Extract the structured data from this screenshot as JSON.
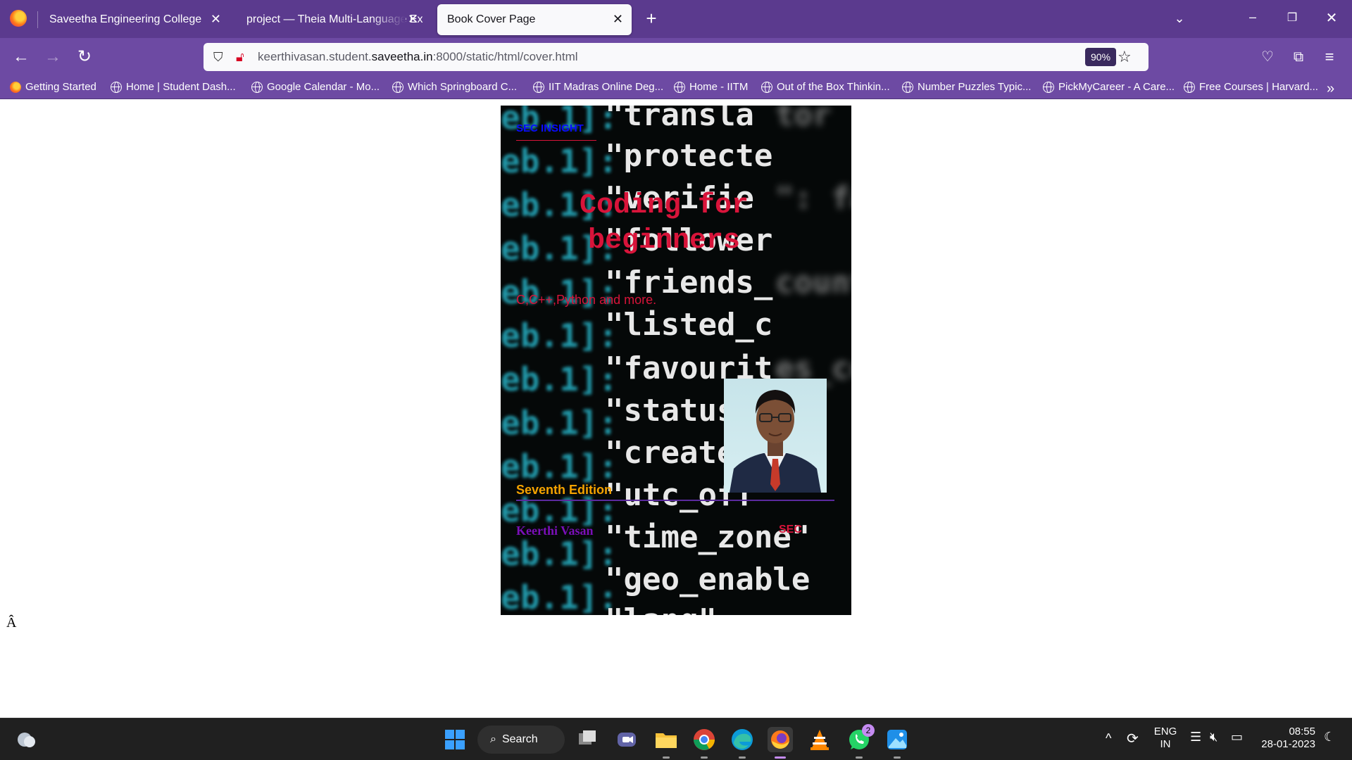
{
  "tabs": [
    {
      "label": "Saveetha Engineering College",
      "active": false
    },
    {
      "label": "project — Theia Multi-Language Ex",
      "active": false
    },
    {
      "label": "Book Cover Page",
      "active": true
    }
  ],
  "toolbar": {
    "url_prefix": "keerthivasan.student.",
    "url_domain": "saveetha.in",
    "url_suffix": ":8000/static/html/cover.html",
    "zoom": "90%"
  },
  "bookmarks": [
    {
      "label": "Getting Started",
      "icon": "firefox-icon"
    },
    {
      "label": "Home | Student Dash...",
      "icon": "globe-icon"
    },
    {
      "label": "Google Calendar - Mo...",
      "icon": "globe-icon"
    },
    {
      "label": "Which Springboard C...",
      "icon": "globe-icon"
    },
    {
      "label": "IIT Madras Online Deg...",
      "icon": "globe-icon"
    },
    {
      "label": "Home - IITM",
      "icon": "globe-icon"
    },
    {
      "label": "Out of the Box Thinkin...",
      "icon": "globe-icon"
    },
    {
      "label": "Number Puzzles Typic...",
      "icon": "globe-icon"
    },
    {
      "label": "PickMyCareer - A Care...",
      "icon": "globe-icon"
    },
    {
      "label": "Free Courses | Harvard...",
      "icon": "globe-icon"
    }
  ],
  "cover": {
    "insight": "SEC INSIGHT",
    "title_line1": "Coding for",
    "title_line2": "beginners",
    "subtitle": "C,C++,Python and more.",
    "edition": "Seventh Edition",
    "author": "Keerthi Vasan",
    "publisher": "SEC",
    "colors": {
      "title": "#d8143a",
      "insight": "#0a0aff",
      "edition": "#f5a300",
      "author": "#7a0fb8",
      "rule": "#5b2a9e"
    }
  },
  "stray_char": "Â",
  "taskbar": {
    "search_label": "Search",
    "whatsapp_badge": "2",
    "lang_top": "ENG",
    "lang_bottom": "IN",
    "time": "08:55",
    "date": "28-01-2023"
  }
}
